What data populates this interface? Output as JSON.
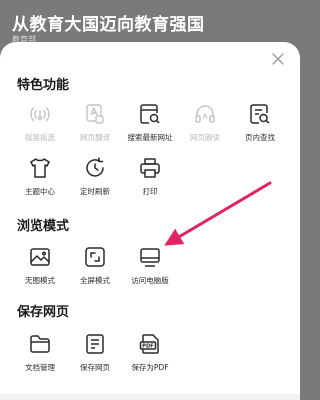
{
  "background": {
    "title": "从教育大国迈向教育强国",
    "subtitle": "教育部"
  },
  "sheet": {
    "close_icon": "close-icon",
    "sections": [
      {
        "title": "特色功能",
        "items": [
          {
            "label": "摇晃摇选",
            "icon": "shake-icon",
            "disabled": true
          },
          {
            "label": "网页翻译",
            "icon": "translate-icon",
            "disabled": true
          },
          {
            "label": "搜索最新网址",
            "icon": "search-page-icon",
            "disabled": false
          },
          {
            "label": "网页朗读",
            "icon": "headphones-icon",
            "disabled": true
          },
          {
            "label": "页内查找",
            "icon": "find-in-page-icon",
            "disabled": false
          },
          {
            "label": "主题中心",
            "icon": "shirt-icon",
            "disabled": false
          },
          {
            "label": "定时刷新",
            "icon": "timer-refresh-icon",
            "disabled": false
          },
          {
            "label": "打印",
            "icon": "printer-icon",
            "disabled": false
          }
        ]
      },
      {
        "title": "浏览模式",
        "items": [
          {
            "label": "无图模式",
            "icon": "no-image-icon",
            "disabled": false
          },
          {
            "label": "全屏模式",
            "icon": "fullscreen-icon",
            "disabled": false
          },
          {
            "label": "访问电脑版",
            "icon": "desktop-icon",
            "disabled": false
          }
        ]
      },
      {
        "title": "保存网页",
        "items": [
          {
            "label": "文档管理",
            "icon": "folder-icon",
            "disabled": false
          },
          {
            "label": "保存网页",
            "icon": "save-page-icon",
            "disabled": false
          },
          {
            "label": "保存为PDF",
            "icon": "pdf-icon",
            "disabled": false
          }
        ]
      }
    ]
  },
  "annotation": {
    "arrow_color": "#e0245e"
  }
}
